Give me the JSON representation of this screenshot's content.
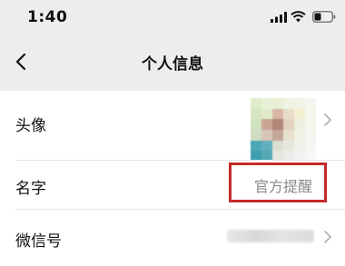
{
  "status_bar": {
    "time": "1:40",
    "icons": [
      "signal-icon",
      "wifi-icon",
      "battery-icon"
    ]
  },
  "nav": {
    "title": "个人信息",
    "back_icon": "chevron-left-icon"
  },
  "rows": [
    {
      "label": "头像",
      "value_type": "avatar-image",
      "has_chevron": true
    },
    {
      "label": "名字",
      "value": "官方提醒",
      "highlighted": true,
      "highlight_color": "#c42b2b"
    },
    {
      "label": "微信号",
      "value_type": "redacted",
      "has_chevron": true
    }
  ],
  "colors": {
    "nav_background": "#ededed",
    "value_text": "#8a8a8a",
    "highlight": "#c42b2b"
  }
}
